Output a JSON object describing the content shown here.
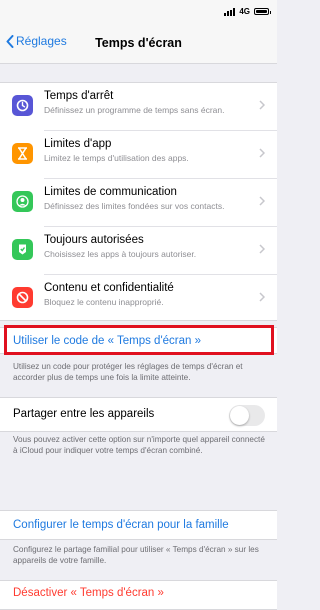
{
  "status_bar": {
    "network": "4G"
  },
  "nav": {
    "back_label": "Réglages",
    "title": "Temps d'écran"
  },
  "settings": [
    {
      "title": "Temps d'arrêt",
      "subtitle": "Définissez un programme de temps sans écran.",
      "icon": "downtime-icon",
      "color": "#5856d6"
    },
    {
      "title": "Limites d'app",
      "subtitle": "Limitez le temps d'utilisation des apps.",
      "icon": "hourglass-icon",
      "color": "#ff9500"
    },
    {
      "title": "Limites de communication",
      "subtitle": "Définissez des limites fondées sur vos contacts.",
      "icon": "contact-icon",
      "color": "#34c759"
    },
    {
      "title": "Toujours autorisées",
      "subtitle": "Choisissez les apps à toujours autoriser.",
      "icon": "checkmark-icon",
      "color": "#34c759"
    },
    {
      "title": "Contenu et confidentialité",
      "subtitle": "Bloquez le contenu inapproprié.",
      "icon": "restriction-icon",
      "color": "#ff3b30"
    }
  ],
  "passcode": {
    "label": "Utiliser le code de « Temps d'écran »",
    "footer": "Utilisez un code pour protéger les réglages de temps d'écran et accorder plus de temps une fois la limite atteinte."
  },
  "share": {
    "label": "Partager entre les appareils",
    "enabled": false,
    "footer": "Vous pouvez activer cette option sur n'importe quel appareil connecté à iCloud pour indiquer votre temps d'écran combiné."
  },
  "family": {
    "label": "Configurer le temps d'écran pour la famille",
    "footer": "Configurez le partage familial pour utiliser « Temps d'écran » sur les appareils de votre famille."
  },
  "disable": {
    "label": "Désactiver « Temps d'écran »"
  },
  "colors": {
    "accent": "#1f7ae0",
    "destructive": "#ff3b30",
    "highlight_box": "#e0101f"
  }
}
